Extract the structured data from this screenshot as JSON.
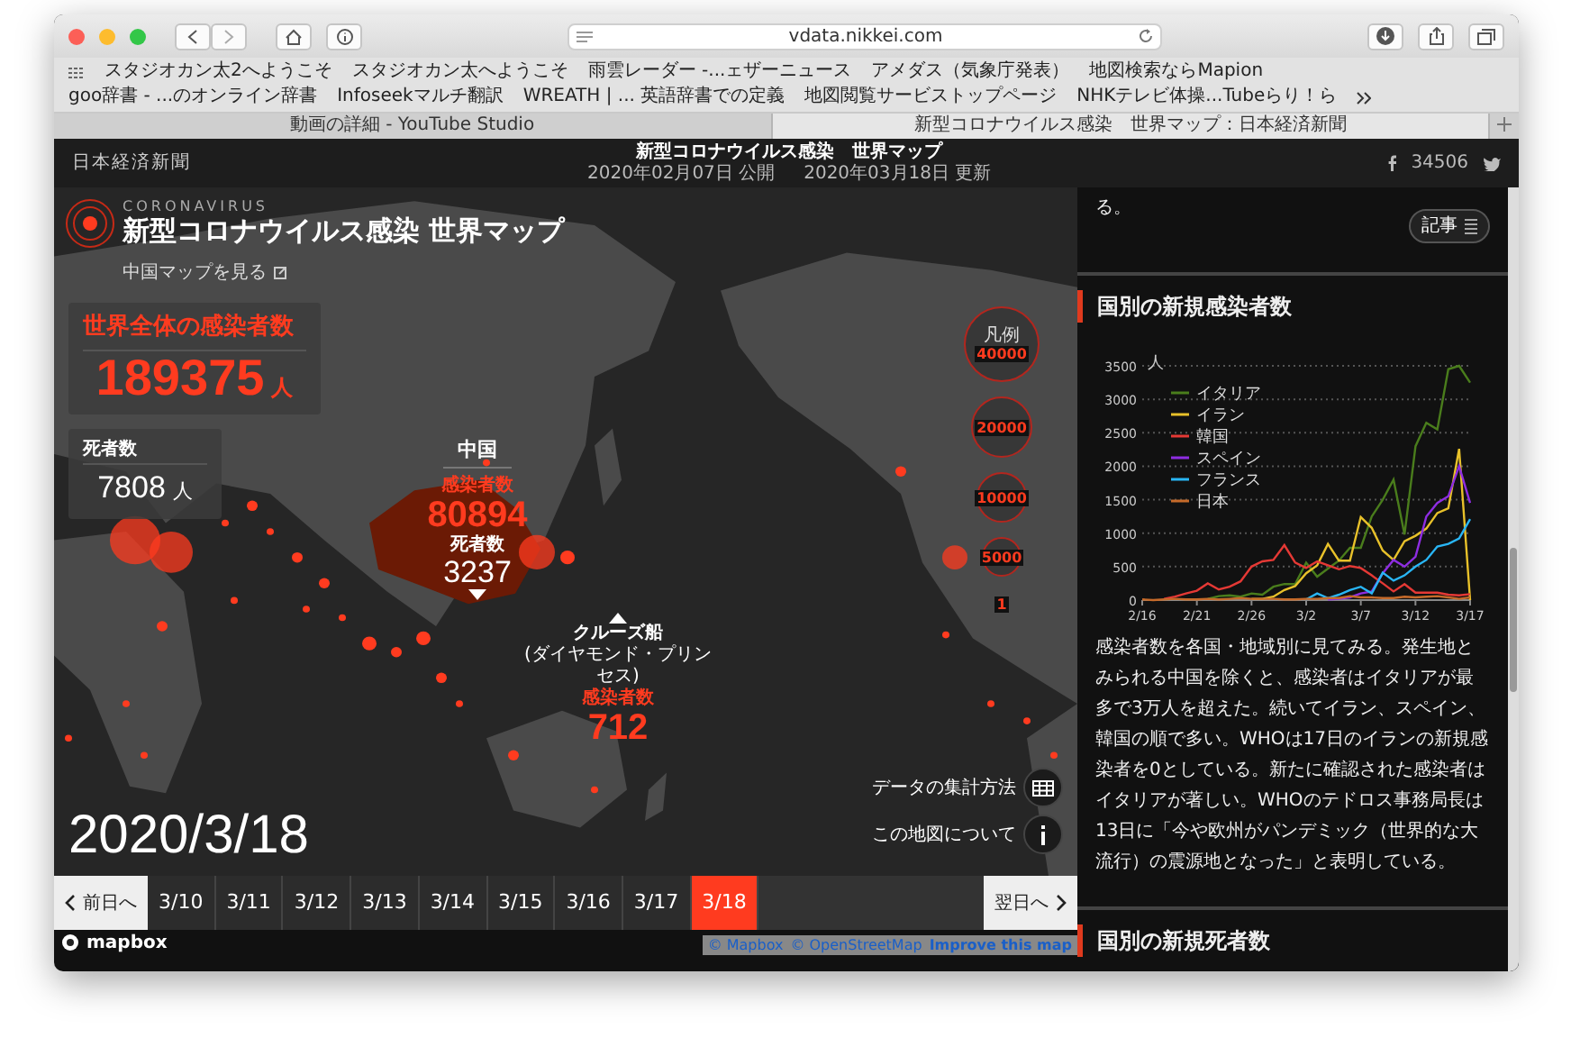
{
  "browser": {
    "address": "vdata.nikkei.com",
    "bookmarks": [
      "スタジオカン太2へようこそ",
      "スタジオカン太へようこそ",
      "雨雲レーダー -...ェザーニュース",
      "アメダス（気象庁発表）",
      "地図検索ならMapion",
      "goo辞書 - ...のオンライン辞書",
      "Infoseekマルチ翻訳",
      "WREATH | ... 英語辞書での定義",
      "地図閲覧サービストップページ",
      "NHKテレビ体操...Tubeらり！ら"
    ],
    "tabs": [
      {
        "label": "動画の詳細 - YouTube Studio",
        "selected": false
      },
      {
        "label": "新型コロナウイルス感染　世界マップ：日本経済新聞",
        "selected": true
      }
    ]
  },
  "site_header": {
    "logo": "日本経済新聞",
    "title": "新型コロナウイルス感染　世界マップ",
    "published": "2020年02月07日 公開",
    "updated": "2020年03月18日 更新",
    "facebook_count": "34506"
  },
  "map": {
    "kicker": "CORONAVIRUS",
    "title": "新型コロナウイルス感染 世界マップ",
    "china_map_link": "中国マップを見る",
    "world_cases": {
      "label": "世界全体の感染者数",
      "value": "189375",
      "unit": "人"
    },
    "world_deaths": {
      "label": "死者数",
      "value": "7808",
      "unit": "人"
    },
    "china": {
      "name": "中国",
      "cases_label": "感染者数",
      "cases": "80894",
      "deaths_label": "死者数",
      "deaths": "3237"
    },
    "cruise_ship": {
      "name": "クルーズ船",
      "subtitle": "(ダイヤモンド・プリンセス)",
      "cases_label": "感染者数",
      "cases": "712"
    },
    "legend": {
      "title": "凡例",
      "sizes": [
        "40000",
        "20000",
        "10000",
        "5000",
        "1"
      ]
    },
    "date": "2020/3/18",
    "controls": [
      {
        "label": "データの集計方法",
        "kind": "table"
      },
      {
        "label": "この地図について",
        "kind": "info"
      }
    ],
    "timeline": {
      "prev": "前日へ",
      "next": "翌日へ",
      "dates": [
        {
          "label": "3/10",
          "selected": false
        },
        {
          "label": "3/11",
          "selected": false
        },
        {
          "label": "3/12",
          "selected": false
        },
        {
          "label": "3/13",
          "selected": false
        },
        {
          "label": "3/14",
          "selected": false
        },
        {
          "label": "3/15",
          "selected": false
        },
        {
          "label": "3/16",
          "selected": false
        },
        {
          "label": "3/17",
          "selected": false
        },
        {
          "label": "3/18",
          "selected": true
        }
      ]
    },
    "logo": "mapbox",
    "attribution": [
      "© Mapbox",
      "© OpenStreetMap",
      "Improve this map"
    ]
  },
  "article": {
    "fragment": "る。",
    "article_button": "記事",
    "sections": [
      {
        "heading": "国別の新規感染者数",
        "chart_data": {
          "type": "line",
          "ylabel": "人",
          "categories": [
            "2/16",
            null,
            null,
            null,
            null,
            "2/21",
            null,
            null,
            null,
            null,
            "2/26",
            null,
            null,
            null,
            null,
            "3/2",
            null,
            null,
            null,
            null,
            "3/7",
            null,
            null,
            null,
            null,
            "3/12",
            null,
            null,
            null,
            null,
            "3/17"
          ],
          "ylim": [
            0,
            3500
          ],
          "yticks": [
            0,
            500,
            1000,
            1500,
            2000,
            2500,
            3000,
            3500
          ],
          "grid": true,
          "legend": "upper left",
          "series": [
            {
              "name": "イタリア",
              "color": "#4a7d1c",
              "values": [
                null,
                null,
                null,
                null,
                null,
                null,
                20,
                60,
                70,
                50,
                100,
                80,
                200,
                240,
                240,
                560,
                350,
                470,
                590,
                780,
                780,
                1250,
                1500,
                1800,
                980,
                2300,
                2650,
                2550,
                3450,
                3500,
                3250
              ]
            },
            {
              "name": "イラン",
              "color": "#e8c12a",
              "values": [
                null,
                null,
                null,
                null,
                null,
                null,
                null,
                null,
                null,
                null,
                20,
                20,
                50,
                150,
                210,
                400,
                520,
                840,
                590,
                590,
                1240,
                1080,
                740,
                600,
                880,
                960,
                1070,
                1300,
                1370,
                2260,
                0
              ]
            },
            {
              "name": "韓国",
              "color": "#e53935",
              "values": [
                null,
                null,
                20,
                50,
                100,
                140,
                250,
                160,
                200,
                280,
                500,
                580,
                600,
                820,
                560,
                480,
                580,
                520,
                460,
                510,
                480,
                370,
                250,
                130,
                240,
                110,
                110,
                110,
                80,
                70,
                90
              ]
            },
            {
              "name": "スペイン",
              "color": "#8e2de2",
              "values": [
                null,
                null,
                null,
                null,
                null,
                null,
                null,
                null,
                null,
                null,
                null,
                null,
                null,
                null,
                null,
                null,
                null,
                10,
                20,
                40,
                100,
                130,
                400,
                600,
                500,
                650,
                1250,
                1450,
                1550,
                2000,
                1450
              ]
            },
            {
              "name": "フランス",
              "color": "#29b6f6",
              "values": [
                null,
                null,
                null,
                null,
                null,
                null,
                null,
                null,
                null,
                null,
                null,
                null,
                null,
                null,
                null,
                10,
                100,
                30,
                80,
                150,
                200,
                100,
                410,
                290,
                370,
                500,
                600,
                800,
                840,
                920,
                1210
              ]
            },
            {
              "name": "日本",
              "color": "#c56a2a",
              "values": [
                10,
                0,
                10,
                20,
                10,
                10,
                20,
                10,
                20,
                30,
                20,
                20,
                20,
                10,
                10,
                20,
                20,
                30,
                30,
                60,
                40,
                40,
                30,
                30,
                50,
                40,
                50,
                60,
                40,
                20,
                40
              ]
            }
          ]
        },
        "paragraph": "感染者数を各国・地域別に見てみる。発生地とみられる中国を除くと、感染者はイタリアが最多で3万人を超えた。続いてイラン、スペイン、韓国の順で多い。WHOは17日のイランの新規感染者を0としている。新たに確認された感染者はイタリアが著しい。WHOのテドロス事務局長は13日に「今や欧州がパンデミック（世界的な大流行）の震源地となった」と表明している。"
      },
      {
        "heading": "国別の新規死者数"
      }
    ]
  }
}
